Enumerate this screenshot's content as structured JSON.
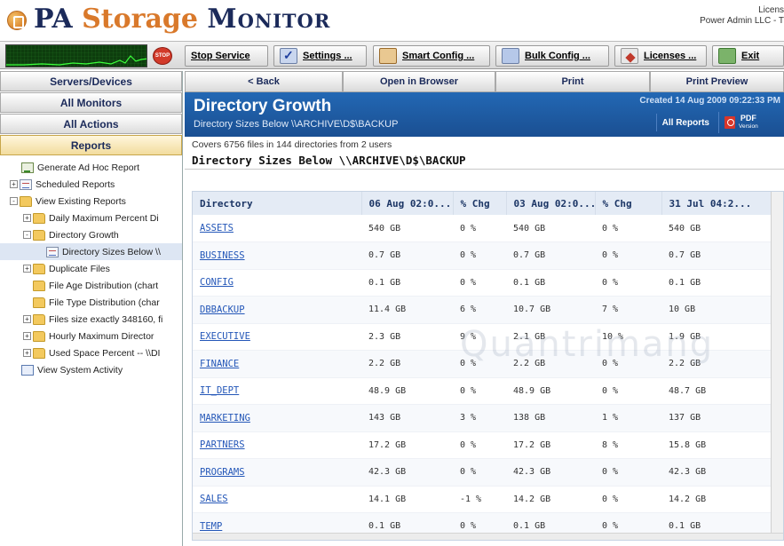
{
  "header": {
    "title_pa": "PA",
    "title_storage": "Storage",
    "title_monitor": "Monitor",
    "license_line1": "Licens",
    "license_line2": "Power Admin LLC - T"
  },
  "toolbar": {
    "stop_icon_text": "STOP",
    "buttons": [
      {
        "label": "Stop Service",
        "icon": "stop-icon"
      },
      {
        "label": "Settings ...",
        "icon": "checklist-icon"
      },
      {
        "label": "Smart Config ...",
        "icon": "user-icon"
      },
      {
        "label": "Bulk Config ...",
        "icon": "bulk-icon"
      },
      {
        "label": "Licenses ...",
        "icon": "license-icon"
      },
      {
        "label": "Exit",
        "icon": "exit-icon"
      }
    ]
  },
  "left_nav": {
    "buttons": [
      "Servers/Devices",
      "All Monitors",
      "All Actions",
      "Reports"
    ],
    "selected": "Reports",
    "tree": [
      {
        "label": "Generate Ad Hoc Report",
        "icon": "report-icon",
        "expander": ""
      },
      {
        "label": "Scheduled Reports",
        "icon": "doc-icon",
        "expander": "+"
      },
      {
        "label": "View Existing Reports",
        "icon": "folder-icon",
        "expander": "-"
      },
      {
        "label": "Daily Maximum Percent Di",
        "icon": "folder-icon",
        "expander": "+"
      },
      {
        "label": "Directory Growth",
        "icon": "folder-icon",
        "expander": "-"
      },
      {
        "label": "Directory Sizes Below \\\\",
        "icon": "doc-icon",
        "expander": ""
      },
      {
        "label": "Duplicate Files",
        "icon": "folder-icon",
        "expander": "+"
      },
      {
        "label": "File Age Distribution (chart",
        "icon": "folder-icon",
        "expander": ""
      },
      {
        "label": "File Type Distribution (char",
        "icon": "folder-icon",
        "expander": ""
      },
      {
        "label": "Files  size exactly 348160, fi",
        "icon": "folder-icon",
        "expander": "+"
      },
      {
        "label": "Hourly Maximum Director",
        "icon": "folder-icon",
        "expander": "+"
      },
      {
        "label": "Used Space Percent -- \\\\DI",
        "icon": "folder-icon",
        "expander": "+"
      },
      {
        "label": "View System Activity",
        "icon": "activity-icon",
        "expander": ""
      }
    ]
  },
  "report_nav": {
    "back": "< Back",
    "open_browser": "Open in Browser",
    "print": "Print",
    "print_preview": "Print Preview"
  },
  "report": {
    "title": "Directory Growth",
    "subtitle": "Directory Sizes Below \\\\ARCHIVE\\D$\\BACKUP",
    "created": "Created 14 Aug 2009 09:22:33 PM",
    "all_reports": "All Reports",
    "pdf_label": "PDF",
    "pdf_sub": "Version",
    "coverage": "Covers 6756 files in 144 directories from 2 users",
    "section_title": "Directory Sizes Below \\\\ARCHIVE\\D$\\BACKUP"
  },
  "table": {
    "columns": [
      "Directory",
      "06 Aug 02:0...",
      "% Chg",
      "03 Aug 02:0...",
      "% Chg",
      "31 Jul 04:2..."
    ],
    "rows": [
      [
        "ASSETS",
        "540 GB",
        "0 %",
        "540 GB",
        "0 %",
        "540 GB"
      ],
      [
        "BUSINESS",
        "0.7 GB",
        "0 %",
        "0.7 GB",
        "0 %",
        "0.7 GB"
      ],
      [
        "CONFIG",
        "0.1 GB",
        "0 %",
        "0.1 GB",
        "0 %",
        "0.1 GB"
      ],
      [
        "DBBACKUP",
        "11.4 GB",
        "6 %",
        "10.7 GB",
        "7 %",
        "10 GB"
      ],
      [
        "EXECUTIVE",
        "2.3 GB",
        "9 %",
        "2.1 GB",
        "10 %",
        "1.9 GB"
      ],
      [
        "FINANCE",
        "2.2 GB",
        "0 %",
        "2.2 GB",
        "0 %",
        "2.2 GB"
      ],
      [
        "IT_DEPT",
        "48.9 GB",
        "0 %",
        "48.9 GB",
        "0 %",
        "48.7 GB"
      ],
      [
        "MARKETING",
        "143 GB",
        "3 %",
        "138 GB",
        "1 %",
        "137 GB"
      ],
      [
        "PARTNERS",
        "17.2 GB",
        "0 %",
        "17.2 GB",
        "8 %",
        "15.8 GB"
      ],
      [
        "PROGRAMS",
        "42.3 GB",
        "0 %",
        "42.3 GB",
        "0 %",
        "42.3 GB"
      ],
      [
        "SALES",
        "14.1 GB",
        "-1 %",
        "14.2 GB",
        "0 %",
        "14.2 GB"
      ],
      [
        "TEMP",
        "0.1 GB",
        "0 %",
        "0.1 GB",
        "0 %",
        "0.1 GB"
      ]
    ]
  },
  "watermark": "Quantrimang",
  "colors": {
    "brand_navy": "#1b2a5a",
    "brand_orange": "#d9792b",
    "report_header_blue": "#1f5ea6",
    "link_blue": "#2457b8"
  }
}
